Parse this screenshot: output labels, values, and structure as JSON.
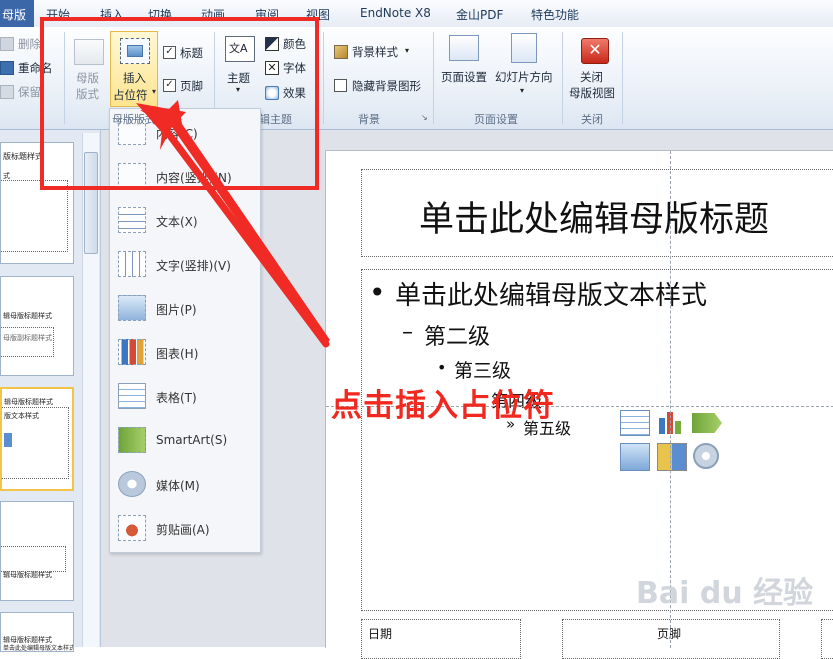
{
  "tabs": [
    {
      "label": "母版",
      "active": true
    },
    {
      "label": "开始"
    },
    {
      "label": "插入"
    },
    {
      "label": "切换"
    },
    {
      "label": "动画"
    },
    {
      "label": "审阅"
    },
    {
      "label": "视图"
    },
    {
      "label": "EndNote X8"
    },
    {
      "label": "金山PDF"
    },
    {
      "label": "特色功能"
    }
  ],
  "ribbon": {
    "edit_group": {
      "delete": "删除",
      "rename": "重命名",
      "preserve": "保留"
    },
    "master_layout": {
      "line1": "母版",
      "line2": "版式"
    },
    "insert_placeholder": {
      "line1": "插入",
      "line2": "占位符"
    },
    "title_check": "标题",
    "footer_check": "页脚",
    "theme": "主题",
    "colors": "颜色",
    "fonts": "字体",
    "effects": "效果",
    "edit_theme_group": "编辑主题",
    "bg_style": "背景样式",
    "hide_bg": "隐藏背景图形",
    "bg_group": "背景",
    "page_setup": "页面设置",
    "slide_orientation": "幻灯片方向",
    "page_setup_group": "页面设置",
    "close_line1": "关闭",
    "close_line2": "母版视图",
    "close_group": "关闭",
    "master_layout_group": "母版版式"
  },
  "dropdown": [
    {
      "label": "内容(C)",
      "icon": "content-placeholder-icon"
    },
    {
      "label": "内容(竖排)(N)",
      "icon": "content-vertical-placeholder-icon"
    },
    {
      "label": "文本(X)",
      "icon": "text-placeholder-icon"
    },
    {
      "label": "文字(竖排)(V)",
      "icon": "text-vertical-placeholder-icon"
    },
    {
      "label": "图片(P)",
      "icon": "picture-placeholder-icon"
    },
    {
      "label": "图表(H)",
      "icon": "chart-placeholder-icon"
    },
    {
      "label": "表格(T)",
      "icon": "table-placeholder-icon"
    },
    {
      "label": "SmartArt(S)",
      "icon": "smartart-placeholder-icon"
    },
    {
      "label": "媒体(M)",
      "icon": "media-placeholder-icon"
    },
    {
      "label": "剪贴画(A)",
      "icon": "clipart-placeholder-icon"
    }
  ],
  "thumbnails": [
    {
      "title": "版标题样式",
      "sub": "式"
    },
    {
      "title": "辑母版标题样式",
      "sub": "母版副标题样式"
    },
    {
      "title": "辑母版标题样式",
      "sub": "版文本样式"
    },
    {
      "title": "辑母版标题样式",
      "sub": ""
    },
    {
      "title": "辑母版标题样式",
      "sub": "单击此处编辑母版文本样式"
    }
  ],
  "slide": {
    "title": "单击此处编辑母版标题",
    "level1": "单击此处编辑母版文本样式",
    "level2": "第二级",
    "level3": "第三级",
    "level4": "第四级",
    "level5": "第五级",
    "date": "日期",
    "footer": "页脚"
  },
  "annotation": "点击插入占位符",
  "watermark": "Bai du 经验",
  "colors": {
    "annotation_red": "#f02a24",
    "tab_active": "#3b67a8"
  }
}
